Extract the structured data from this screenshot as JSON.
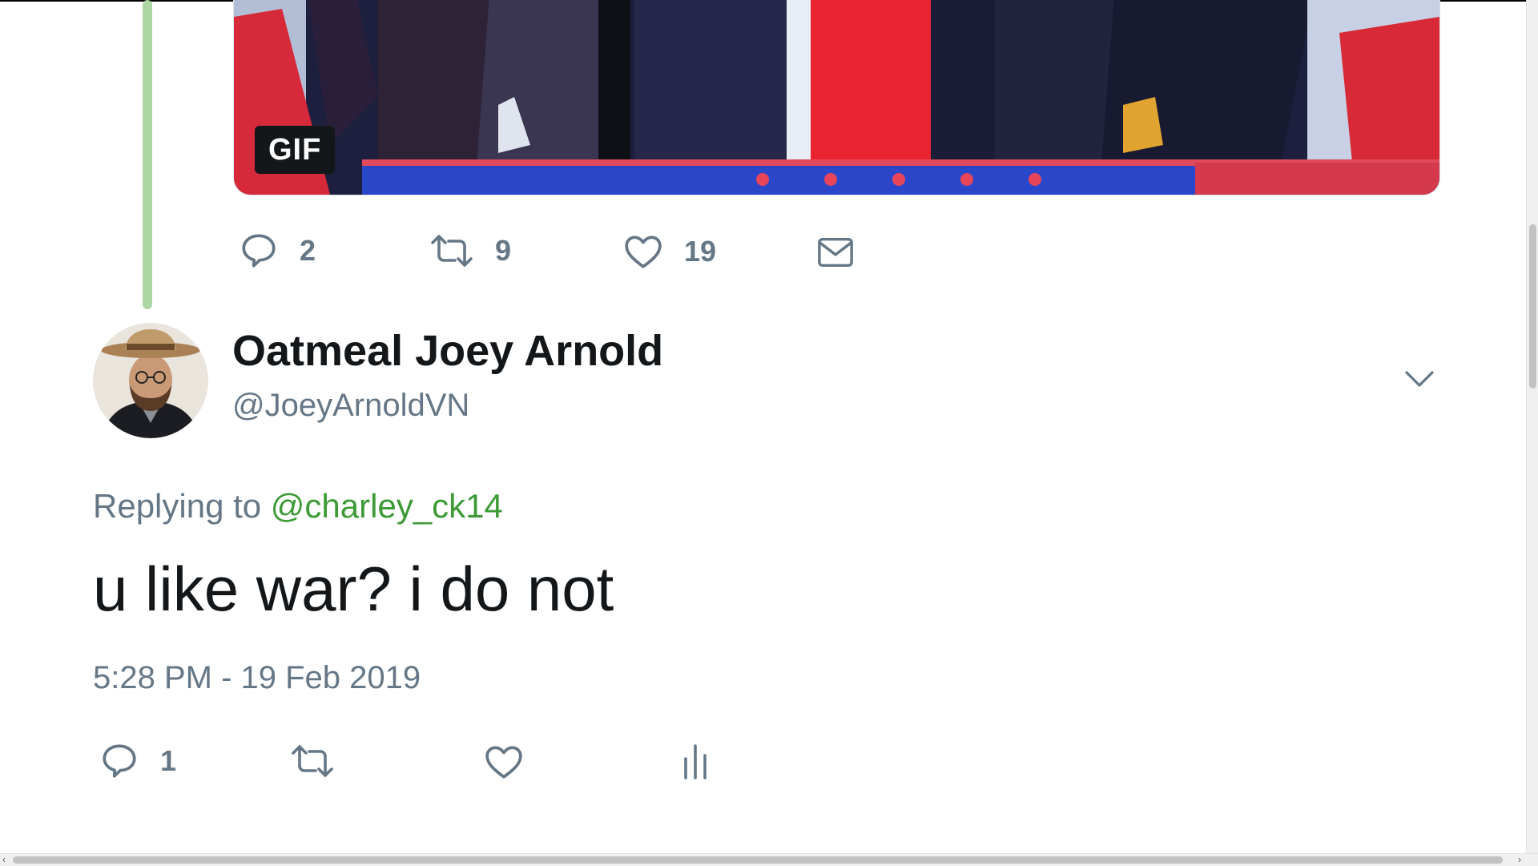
{
  "first_tweet": {
    "media_badge": "GIF",
    "actions": {
      "reply_count": "2",
      "retweet_count": "9",
      "like_count": "19"
    }
  },
  "second_tweet": {
    "display_name": "Oatmeal Joey Arnold",
    "handle": "@JoeyArnoldVN",
    "replying_prefix": "Replying to ",
    "replying_to": "@charley_ck14",
    "text": "u like war? i do not",
    "timestamp": "5:28 PM - 19 Feb 2019",
    "actions": {
      "reply_count": "1"
    }
  },
  "icons": [
    "reply-icon",
    "retweet-icon",
    "like-icon",
    "direct-message-icon",
    "chevron-down-icon",
    "analytics-icon"
  ],
  "colors": {
    "thread_line": "#aed6a5",
    "mention": "#3d9a36",
    "secondary_text": "#657786",
    "primary_text": "#14171a"
  }
}
